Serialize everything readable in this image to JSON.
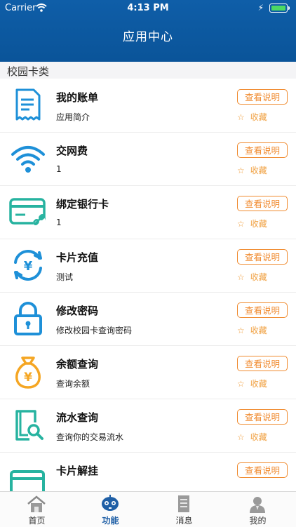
{
  "status_bar": {
    "carrier": "Carrier",
    "time": "4:13 PM"
  },
  "header": {
    "title": "应用中心"
  },
  "section": {
    "label": "校园卡类"
  },
  "items": [
    {
      "name": "我的账单",
      "desc": "应用简介",
      "button": "查看说明",
      "fav": "收藏",
      "icon": "bill-icon"
    },
    {
      "name": "交网费",
      "desc": "1",
      "button": "查看说明",
      "fav": "收藏",
      "icon": "wifi-icon"
    },
    {
      "name": "绑定银行卡",
      "desc": "1",
      "button": "查看说明",
      "fav": "收藏",
      "icon": "bank-card-icon"
    },
    {
      "name": "卡片充值",
      "desc": "测试",
      "button": "查看说明",
      "fav": "收藏",
      "icon": "recharge-icon"
    },
    {
      "name": "修改密码",
      "desc": "修改校园卡查询密码",
      "button": "查看说明",
      "fav": "收藏",
      "icon": "lock-icon"
    },
    {
      "name": "余额查询",
      "desc": "查询余额",
      "button": "查看说明",
      "fav": "收藏",
      "icon": "money-bag-icon"
    },
    {
      "name": "流水查询",
      "desc": "查询你的交易流水",
      "button": "查看说明",
      "fav": "收藏",
      "icon": "search-document-icon"
    },
    {
      "name": "卡片解挂",
      "desc": "",
      "button": "查看说明",
      "fav": "",
      "icon": "card-icon"
    }
  ],
  "tabs": [
    {
      "label": "首页",
      "icon": "home-icon"
    },
    {
      "label": "功能",
      "icon": "robot-icon"
    },
    {
      "label": "消息",
      "icon": "document-icon"
    },
    {
      "label": "我的",
      "icon": "user-icon"
    }
  ],
  "colors": {
    "header": "#0a5499",
    "accent_orange": "#f08a2e",
    "icon_blue": "#1e90d8",
    "icon_teal": "#27b3a0",
    "icon_orange": "#f5a623",
    "tab_active": "#1f5fa6"
  }
}
